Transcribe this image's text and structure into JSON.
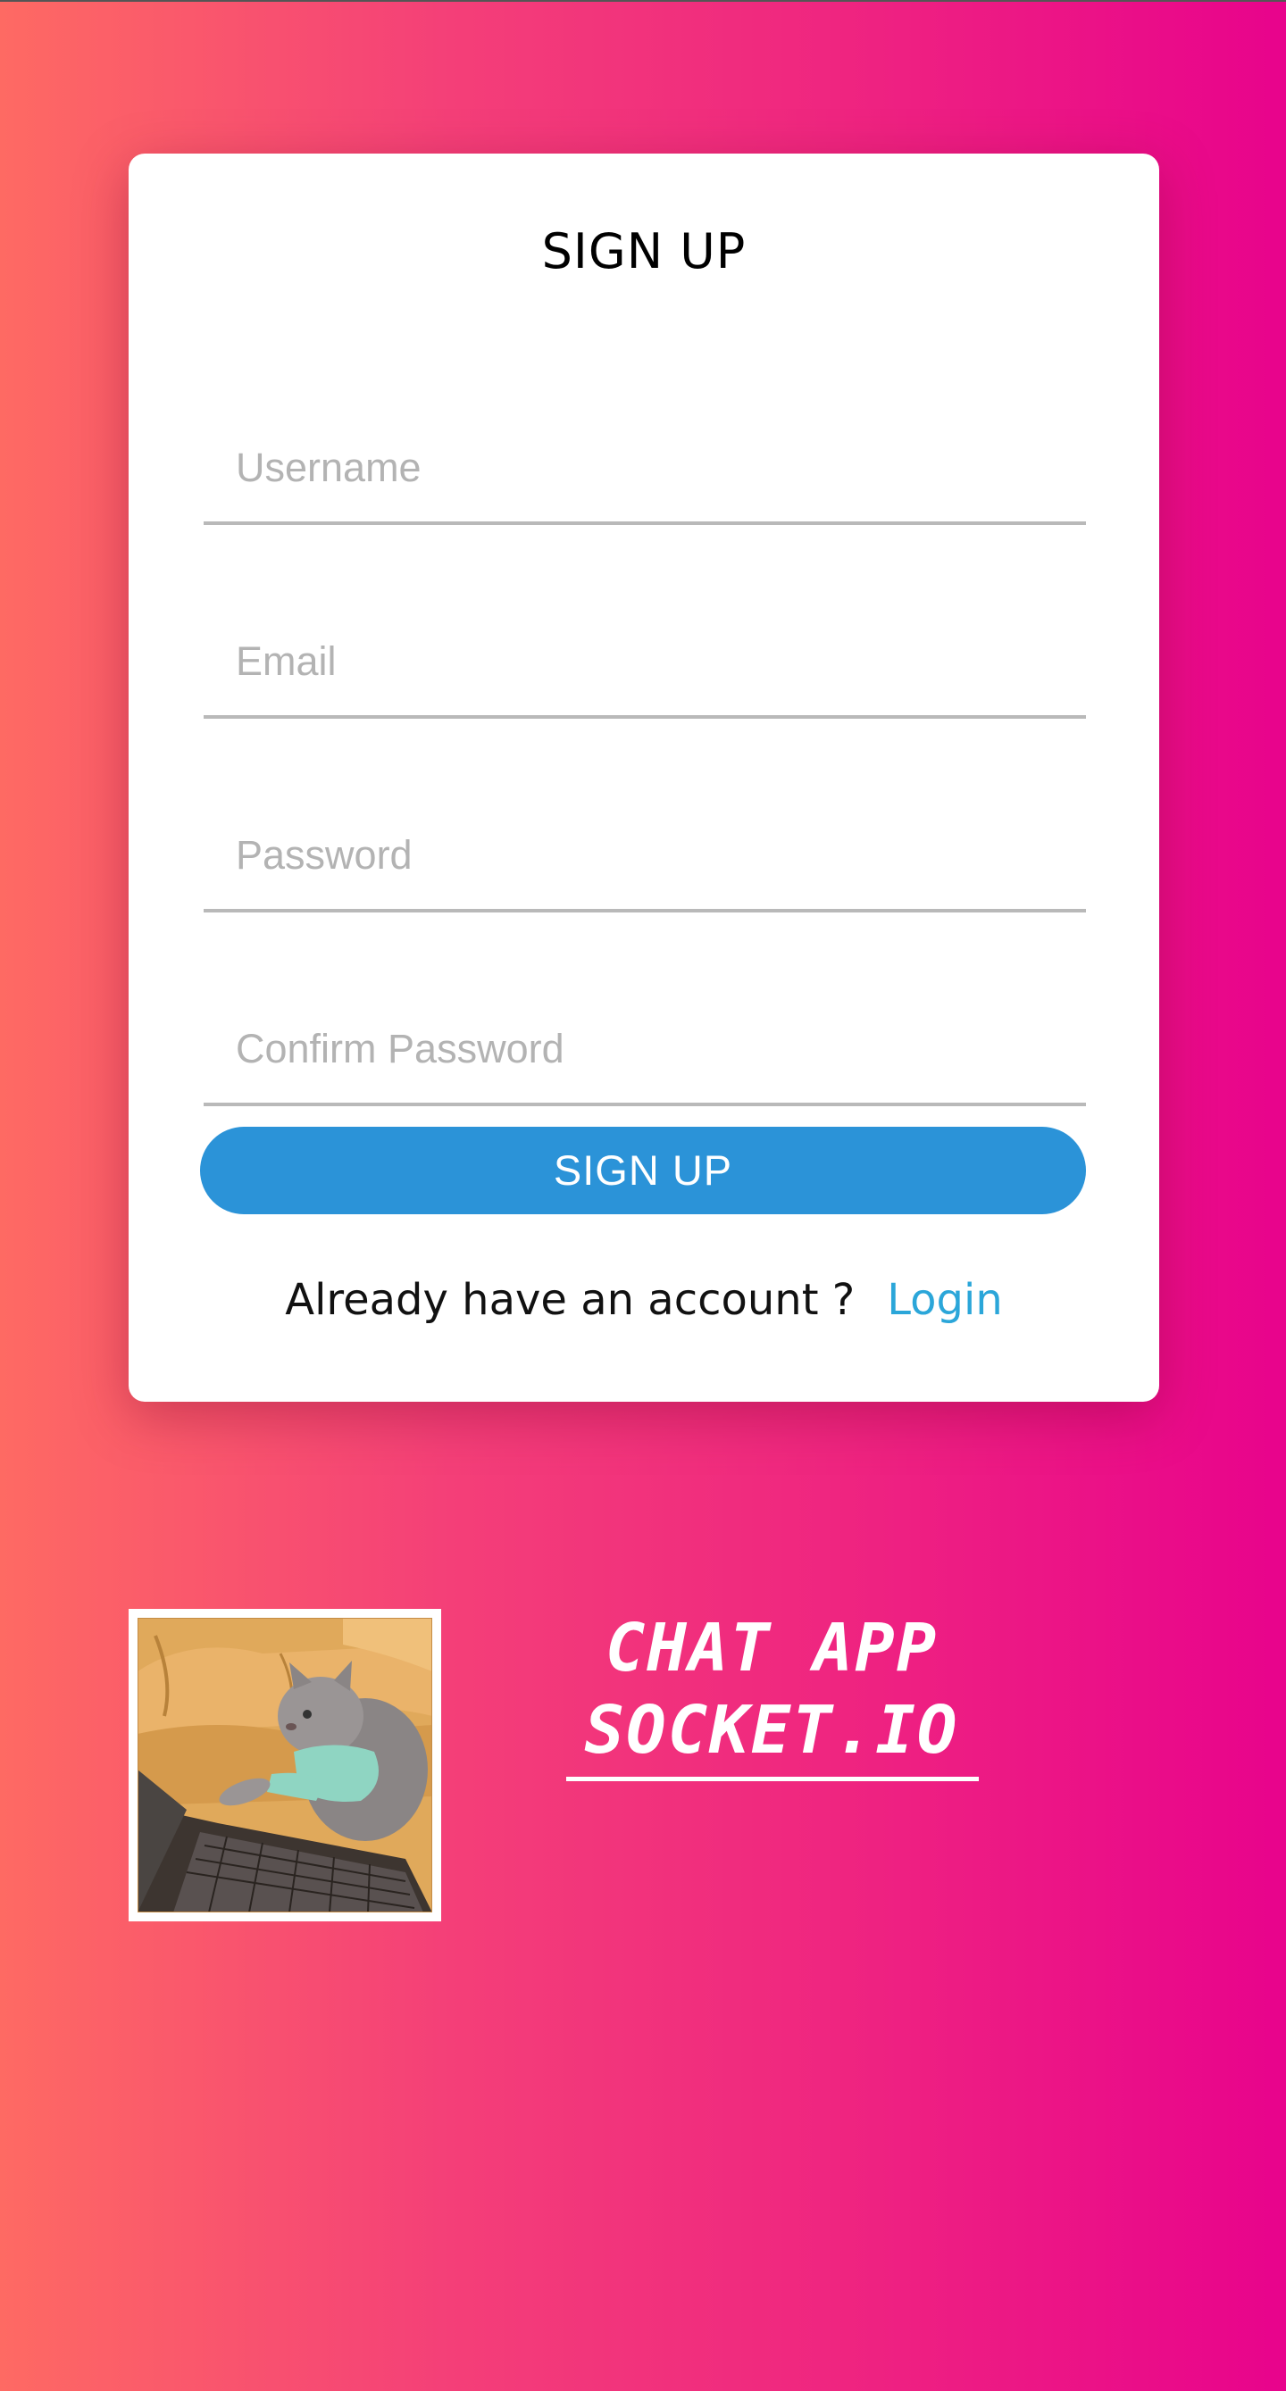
{
  "form": {
    "title": "SIGN UP",
    "fields": [
      {
        "placeholder": "Username",
        "value": ""
      },
      {
        "placeholder": "Email",
        "value": ""
      },
      {
        "placeholder": "Password",
        "value": ""
      },
      {
        "placeholder": "Confirm Password",
        "value": ""
      }
    ],
    "submit_label": "SIGN UP",
    "account_prompt": "Already have an account ?",
    "login_link": "Login"
  },
  "brand": {
    "line1": "CHAT APP",
    "line2": "SOCKET.IO"
  },
  "image": {
    "icon": "cat-typing-on-laptop-image"
  },
  "colors": {
    "gradient_start": "#fe6a63",
    "gradient_end": "#e8038c",
    "button": "#2b93d8",
    "link": "#2ba6d9"
  }
}
